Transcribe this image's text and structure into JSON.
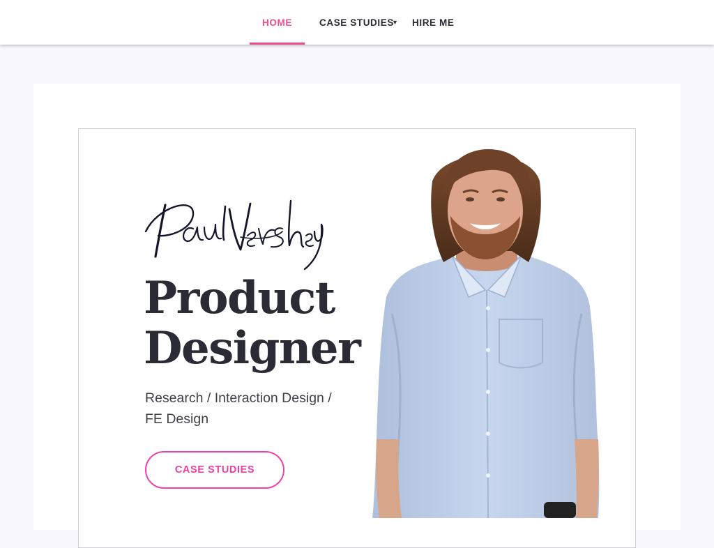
{
  "nav": {
    "home": "HOME",
    "case_studies": "CASE STUDIES",
    "caret_icon": "caret-down-icon",
    "hire_me": "HIRE ME"
  },
  "hero": {
    "signature": "Paul Vershey",
    "title_line1": "Product",
    "title_line2": "Designer",
    "subtitle": "Research / Interaction Design / FE Design",
    "cta": "CASE STUDIES",
    "portrait": "photo of a smiling man with long brown hair and beard in a light blue shirt"
  },
  "colors": {
    "accent_pink": "#ee4f8c",
    "cta_pink": "#e73fa6",
    "text_dark": "#2b2b36",
    "page_bg": "#f8f7fe"
  }
}
